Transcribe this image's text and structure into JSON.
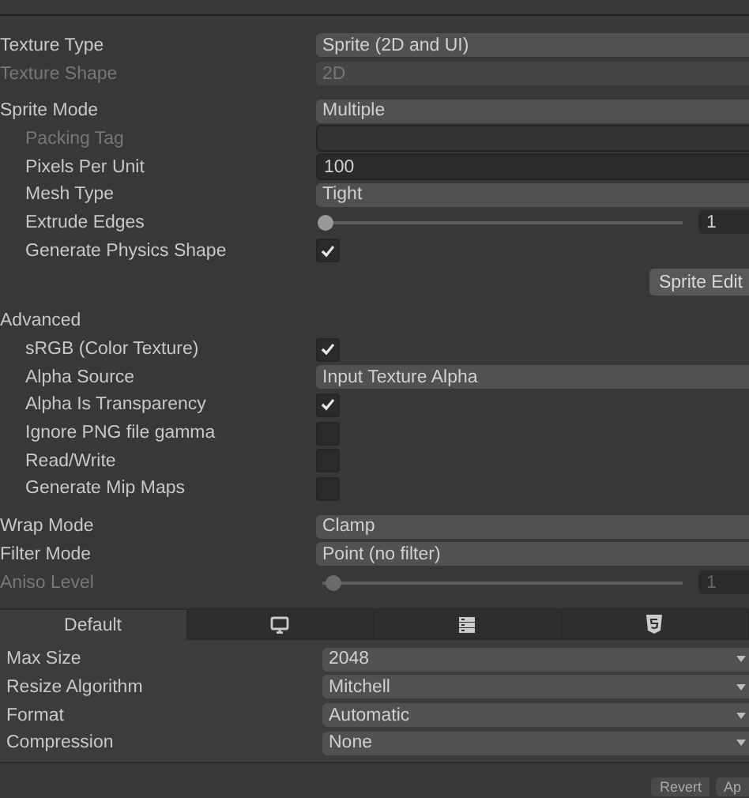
{
  "groups": [
    {
      "rows": [
        {
          "label": "Texture Type",
          "kind": "dropdown",
          "value": "Sprite (2D and UI)",
          "disabled": false,
          "nested": false
        },
        {
          "label": "Texture Shape",
          "kind": "dropdown",
          "value": "2D",
          "disabled": true,
          "nested": false
        }
      ]
    },
    {
      "rows": [
        {
          "label": "Sprite Mode",
          "kind": "dropdown",
          "value": "Multiple",
          "disabled": false,
          "nested": false
        },
        {
          "label": "Packing Tag",
          "kind": "text",
          "value": "",
          "disabled": true,
          "nested": true
        },
        {
          "label": "Pixels Per Unit",
          "kind": "text",
          "value": "100",
          "disabled": false,
          "nested": true
        },
        {
          "label": "Mesh Type",
          "kind": "dropdown",
          "value": "Tight",
          "disabled": false,
          "nested": true
        },
        {
          "label": "Extrude Edges",
          "kind": "slider",
          "level": 0.01,
          "value": "1",
          "disabled": false,
          "nested": true
        },
        {
          "label": "Generate Physics Shape",
          "kind": "checkbox",
          "checked": true,
          "disabled": false,
          "nested": true
        },
        {
          "kind": "button",
          "value": "Sprite Edit"
        }
      ]
    },
    {
      "rows": [
        {
          "label": "Advanced",
          "kind": "header"
        },
        {
          "label": "sRGB (Color Texture)",
          "kind": "checkbox",
          "checked": true,
          "disabled": false,
          "nested": true
        },
        {
          "label": "Alpha Source",
          "kind": "dropdown",
          "value": "Input Texture Alpha",
          "disabled": false,
          "nested": true
        },
        {
          "label": "Alpha Is Transparency",
          "kind": "checkbox",
          "checked": true,
          "disabled": false,
          "nested": true
        },
        {
          "label": "Ignore PNG file gamma",
          "kind": "checkbox",
          "checked": false,
          "disabled": false,
          "nested": true
        },
        {
          "label": "Read/Write",
          "kind": "checkbox",
          "checked": false,
          "disabled": false,
          "nested": true
        },
        {
          "label": "Generate Mip Maps",
          "kind": "checkbox",
          "checked": false,
          "disabled": false,
          "nested": true
        }
      ]
    },
    {
      "rows": [
        {
          "label": "Wrap Mode",
          "kind": "dropdown",
          "value": "Clamp",
          "disabled": false,
          "nested": false
        },
        {
          "label": "Filter Mode",
          "kind": "dropdown",
          "value": "Point (no filter)",
          "disabled": false,
          "nested": false
        },
        {
          "label": "Aniso Level",
          "kind": "slider",
          "level": 0.03,
          "value": "1",
          "disabled": true,
          "nested": false
        }
      ]
    }
  ],
  "platform_tabs": [
    {
      "kind": "label",
      "label": "Default",
      "selected": true
    },
    {
      "kind": "icon",
      "selected": false
    },
    {
      "kind": "icon",
      "selected": false
    },
    {
      "kind": "icon",
      "selected": false
    }
  ],
  "platform_rows": [
    {
      "label": "Max Size",
      "value": "2048"
    },
    {
      "label": "Resize Algorithm",
      "value": "Mitchell"
    },
    {
      "label": "Format",
      "value": "Automatic"
    },
    {
      "label": "Compression",
      "value": "None"
    }
  ],
  "footer_buttons": [
    "Revert",
    "Ap"
  ]
}
